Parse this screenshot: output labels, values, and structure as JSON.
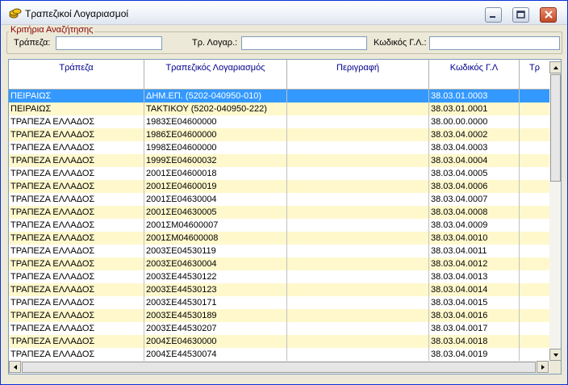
{
  "window": {
    "title": "Τραπεζικοί Λογαριασμοί"
  },
  "criteria": {
    "legend": "Κριτήρια Αναζήτησης",
    "bank_label": "Τράπεζα:",
    "bank_value": "",
    "account_label": "Τρ. Λογαρ.:",
    "account_value": "",
    "gl_label": "Κωδικός Γ.Λ.:",
    "gl_value": ""
  },
  "grid": {
    "columns": [
      "Τράπεζα",
      "Τραπεζικός Λογαριασμός",
      "Περιγραφή",
      "Κωδικός Γ.Λ",
      "Τρ"
    ],
    "rows": [
      [
        "ΠΕΙΡΑΙΩΣ",
        "ΔΗΜ.ΕΠ. (5202-040950-010)",
        "",
        "38.03.01.0003",
        ""
      ],
      [
        "ΠΕΙΡΑΙΩΣ",
        "ΤΑΚΤΙΚΟΥ (5202-040950-222)",
        "",
        "38.03.01.0001",
        ""
      ],
      [
        "ΤΡΑΠΕΖΑ ΕΛΛΑΔΟΣ",
        "1983ΣΕ04600000",
        "",
        "38.00.00.0000",
        ""
      ],
      [
        "ΤΡΑΠΕΖΑ ΕΛΛΑΔΟΣ",
        "1986ΣΕ04600000",
        "",
        "38.03.04.0002",
        ""
      ],
      [
        "ΤΡΑΠΕΖΑ ΕΛΛΑΔΟΣ",
        "1998ΣΕ04600000",
        "",
        "38.03.04.0003",
        ""
      ],
      [
        "ΤΡΑΠΕΖΑ ΕΛΛΑΔΟΣ",
        "1999ΣΕ04600032",
        "",
        "38.03.04.0004",
        ""
      ],
      [
        "ΤΡΑΠΕΖΑ ΕΛΛΑΔΟΣ",
        "2001ΣΕ04600018",
        "",
        "38.03.04.0005",
        ""
      ],
      [
        "ΤΡΑΠΕΖΑ ΕΛΛΑΔΟΣ",
        "2001ΣΕ04600019",
        "",
        "38.03.04.0006",
        ""
      ],
      [
        "ΤΡΑΠΕΖΑ ΕΛΛΑΔΟΣ",
        "2001ΣΕ04630004",
        "",
        "38.03.04.0007",
        ""
      ],
      [
        "ΤΡΑΠΕΖΑ ΕΛΛΑΔΟΣ",
        "2001ΣΕ04630005",
        "",
        "38.03.04.0008",
        ""
      ],
      [
        "ΤΡΑΠΕΖΑ ΕΛΛΑΔΟΣ",
        "2001ΣΜ04600007",
        "",
        "38.03.04.0009",
        ""
      ],
      [
        "ΤΡΑΠΕΖΑ ΕΛΛΑΔΟΣ",
        "2001ΣΜ04600008",
        "",
        "38.03.04.0010",
        ""
      ],
      [
        "ΤΡΑΠΕΖΑ ΕΛΛΑΔΟΣ",
        "2003ΣΕ04530119",
        "",
        "38.03.04.0011",
        ""
      ],
      [
        "ΤΡΑΠΕΖΑ ΕΛΛΑΔΟΣ",
        "2003ΣΕ04630004",
        "",
        "38.03.04.0012",
        ""
      ],
      [
        "ΤΡΑΠΕΖΑ ΕΛΛΑΔΟΣ",
        "2003ΣΕ44530122",
        "",
        "38.03.04.0013",
        ""
      ],
      [
        "ΤΡΑΠΕΖΑ ΕΛΛΑΔΟΣ",
        "2003ΣΕ44530123",
        "",
        "38.03.04.0014",
        ""
      ],
      [
        "ΤΡΑΠΕΖΑ ΕΛΛΑΔΟΣ",
        "2003ΣΕ44530171",
        "",
        "38.03.04.0015",
        ""
      ],
      [
        "ΤΡΑΠΕΖΑ ΕΛΛΑΔΟΣ",
        "2003ΣΕ44530189",
        "",
        "38.03.04.0016",
        ""
      ],
      [
        "ΤΡΑΠΕΖΑ ΕΛΛΑΔΟΣ",
        "2003ΣΕ44530207",
        "",
        "38.03.04.0017",
        ""
      ],
      [
        "ΤΡΑΠΕΖΑ ΕΛΛΑΔΟΣ",
        "2004ΣΕ04630000",
        "",
        "38.03.04.0018",
        ""
      ],
      [
        "ΤΡΑΠΕΖΑ ΕΛΛΑΔΟΣ",
        "2004ΣΕ44530074",
        "",
        "38.03.04.0019",
        ""
      ]
    ],
    "selected_row": 0
  },
  "colors": {
    "selection": "#3399ff",
    "alt_row": "#fff8cc",
    "header_text": "#00008b",
    "legend_text": "#8b0000"
  },
  "icons": {
    "app": "bank-coins-icon",
    "minimize": "minimize-icon",
    "maximize": "maximize-icon",
    "close": "close-icon"
  }
}
